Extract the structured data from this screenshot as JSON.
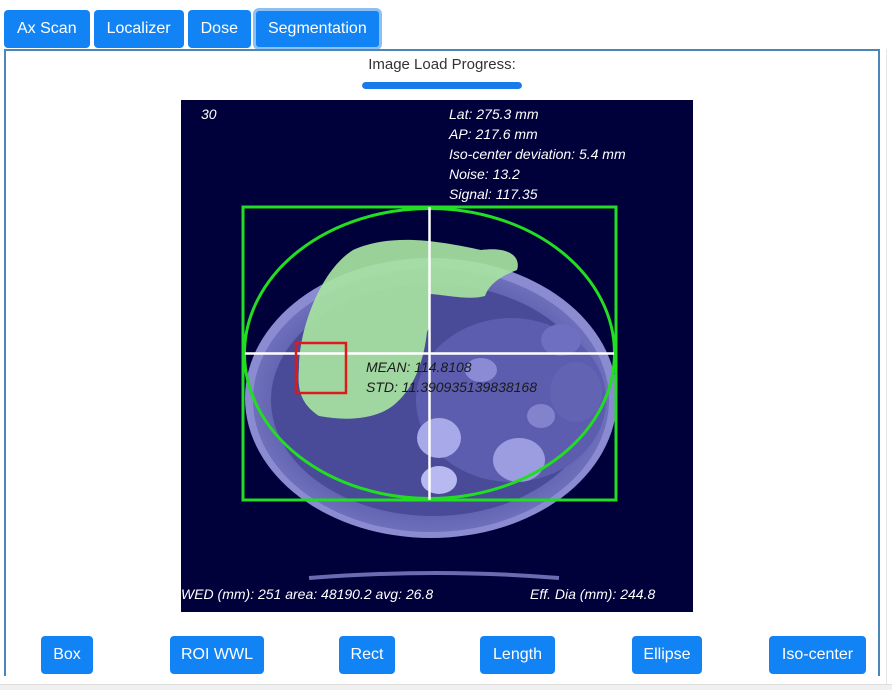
{
  "tabs": [
    {
      "label": "Ax Scan"
    },
    {
      "label": "Localizer"
    },
    {
      "label": "Dose"
    },
    {
      "label": "Segmentation"
    }
  ],
  "active_tab": "Segmentation",
  "progress": {
    "label": "Image Load Progress:",
    "value": 1.0
  },
  "viewer": {
    "slice_number": "30",
    "lat": "Lat: 275.3 mm",
    "ap": "AP: 217.6 mm",
    "iso_deviation": "Iso-center deviation: 5.4 mm",
    "noise": "Noise: 13.2",
    "signal": "Signal: 117.35",
    "roi_mean": "MEAN: 114.8108",
    "roi_std": "STD: 11.390935139838168",
    "wed": "WED (mm): 251 area: 48190.2 avg: 26.8",
    "eff_dia": "Eff. Dia (mm): 244.8"
  },
  "tools": [
    {
      "label": "Box"
    },
    {
      "label": "ROI WWL"
    },
    {
      "label": "Rect"
    },
    {
      "label": "Length"
    },
    {
      "label": "Ellipse"
    },
    {
      "label": "Iso-center"
    }
  ],
  "colors": {
    "button": "#1283f4",
    "viewer_bg": "#00003a",
    "bounding_box": "#22dd22",
    "roi_box": "#dd1a1a",
    "segmentation": "#9ed99e"
  },
  "icons": []
}
